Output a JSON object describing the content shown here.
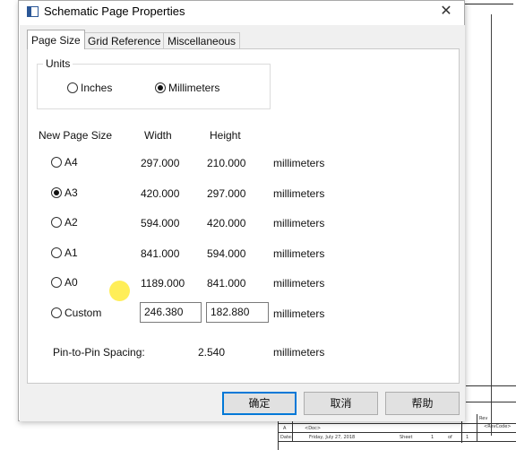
{
  "dialog": {
    "title": "Schematic Page Properties",
    "close_glyph": "✕"
  },
  "tabs": [
    {
      "label": "Page Size",
      "active": true
    },
    {
      "label": "Grid Reference",
      "active": false
    },
    {
      "label": "Miscellaneous",
      "active": false
    }
  ],
  "units": {
    "legend": "Units",
    "options": [
      {
        "label": "Inches",
        "checked": false
      },
      {
        "label": "Millimeters",
        "checked": true
      }
    ]
  },
  "size_table": {
    "headers": {
      "size": "New Page Size",
      "width": "Width",
      "height": "Height"
    },
    "rows": [
      {
        "label": "A4",
        "checked": false,
        "width": "297.000",
        "height": "210.000",
        "unit": "millimeters"
      },
      {
        "label": "A3",
        "checked": true,
        "width": "420.000",
        "height": "297.000",
        "unit": "millimeters"
      },
      {
        "label": "A2",
        "checked": false,
        "width": "594.000",
        "height": "420.000",
        "unit": "millimeters"
      },
      {
        "label": "A1",
        "checked": false,
        "width": "841.000",
        "height": "594.000",
        "unit": "millimeters"
      },
      {
        "label": "A0",
        "checked": false,
        "width": "1189.000",
        "height": "841.000",
        "unit": "millimeters"
      }
    ],
    "custom": {
      "label": "Custom",
      "checked": false,
      "width": "246.380",
      "height": "182.880",
      "unit": "millimeters"
    }
  },
  "pin_spacing": {
    "label": "Pin-to-Pin Spacing:",
    "value": "2.540",
    "unit": "millimeters"
  },
  "buttons": {
    "ok": "确定",
    "cancel": "取消",
    "help": "帮助"
  },
  "title_block": {
    "size_letter": "A",
    "doc_field": "<Doc>",
    "rev_label": "Rev",
    "rev_field": "<RevCode>",
    "date_label": "Date:",
    "date_value": "Friday, July 27, 2018",
    "sheet_label": "Sheet",
    "sheet_num": "1",
    "of_label": "of",
    "sheet_total": "1"
  },
  "colors": {
    "accent": "#0078d7",
    "cursor_highlight": "#ffeb3b"
  }
}
